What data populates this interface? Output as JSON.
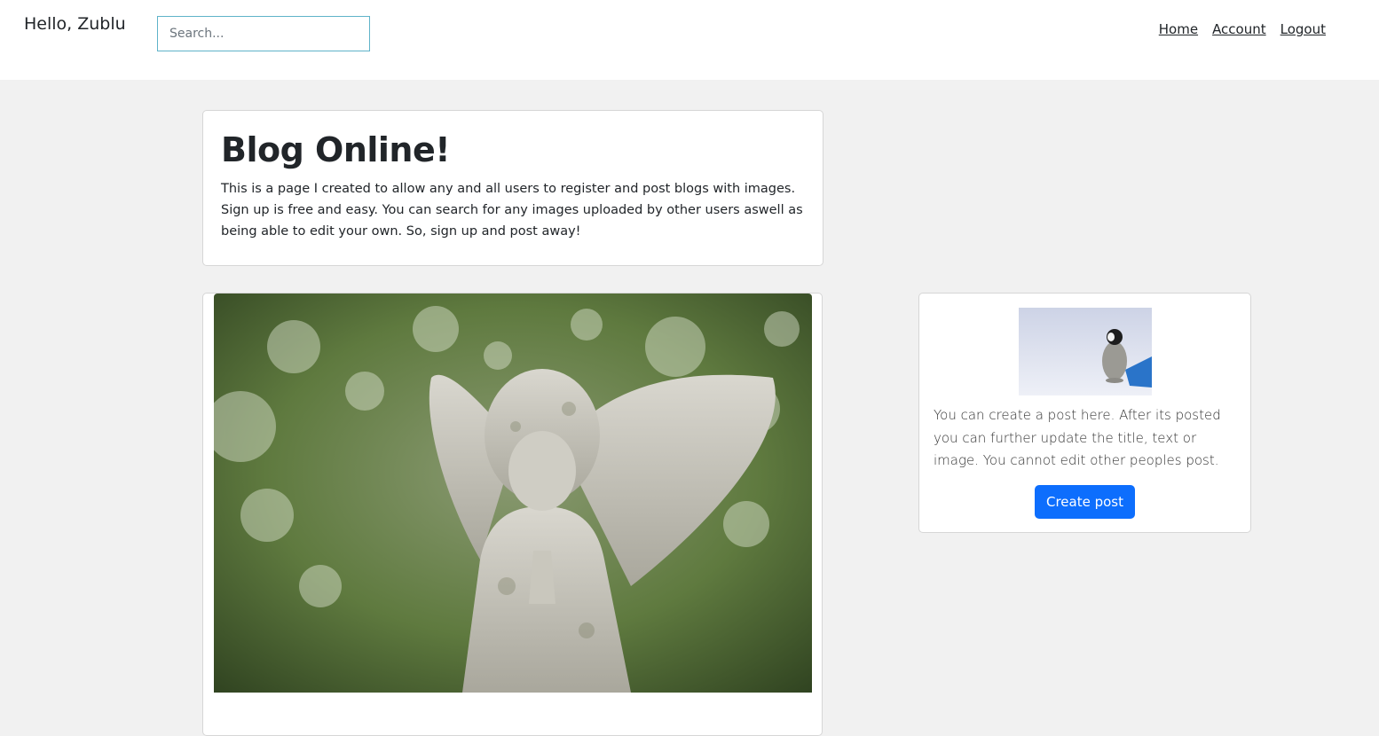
{
  "header": {
    "greeting": "Hello, Zublu",
    "search_placeholder": "Search...",
    "nav": [
      "Home",
      "Account",
      "Logout"
    ]
  },
  "intro": {
    "title": "Blog Online!",
    "text": "This is a page I created to allow any and all users to register and post blogs with images. Sign up is free and easy. You can search for any images uploaded by other users aswell as being able to edit your own. So, sign up and post away!"
  },
  "post": {
    "image": "angel-statue-photo"
  },
  "sidebar": {
    "image": "penguin-photo",
    "text": "You can create a post here. After its posted you can further update the title, text or image. You cannot edit other peoples post.",
    "button_label": "Create post"
  },
  "colors": {
    "accent": "#0d6efd",
    "page_bg": "#f1f1f1",
    "search_border": "#5fb3c9"
  }
}
